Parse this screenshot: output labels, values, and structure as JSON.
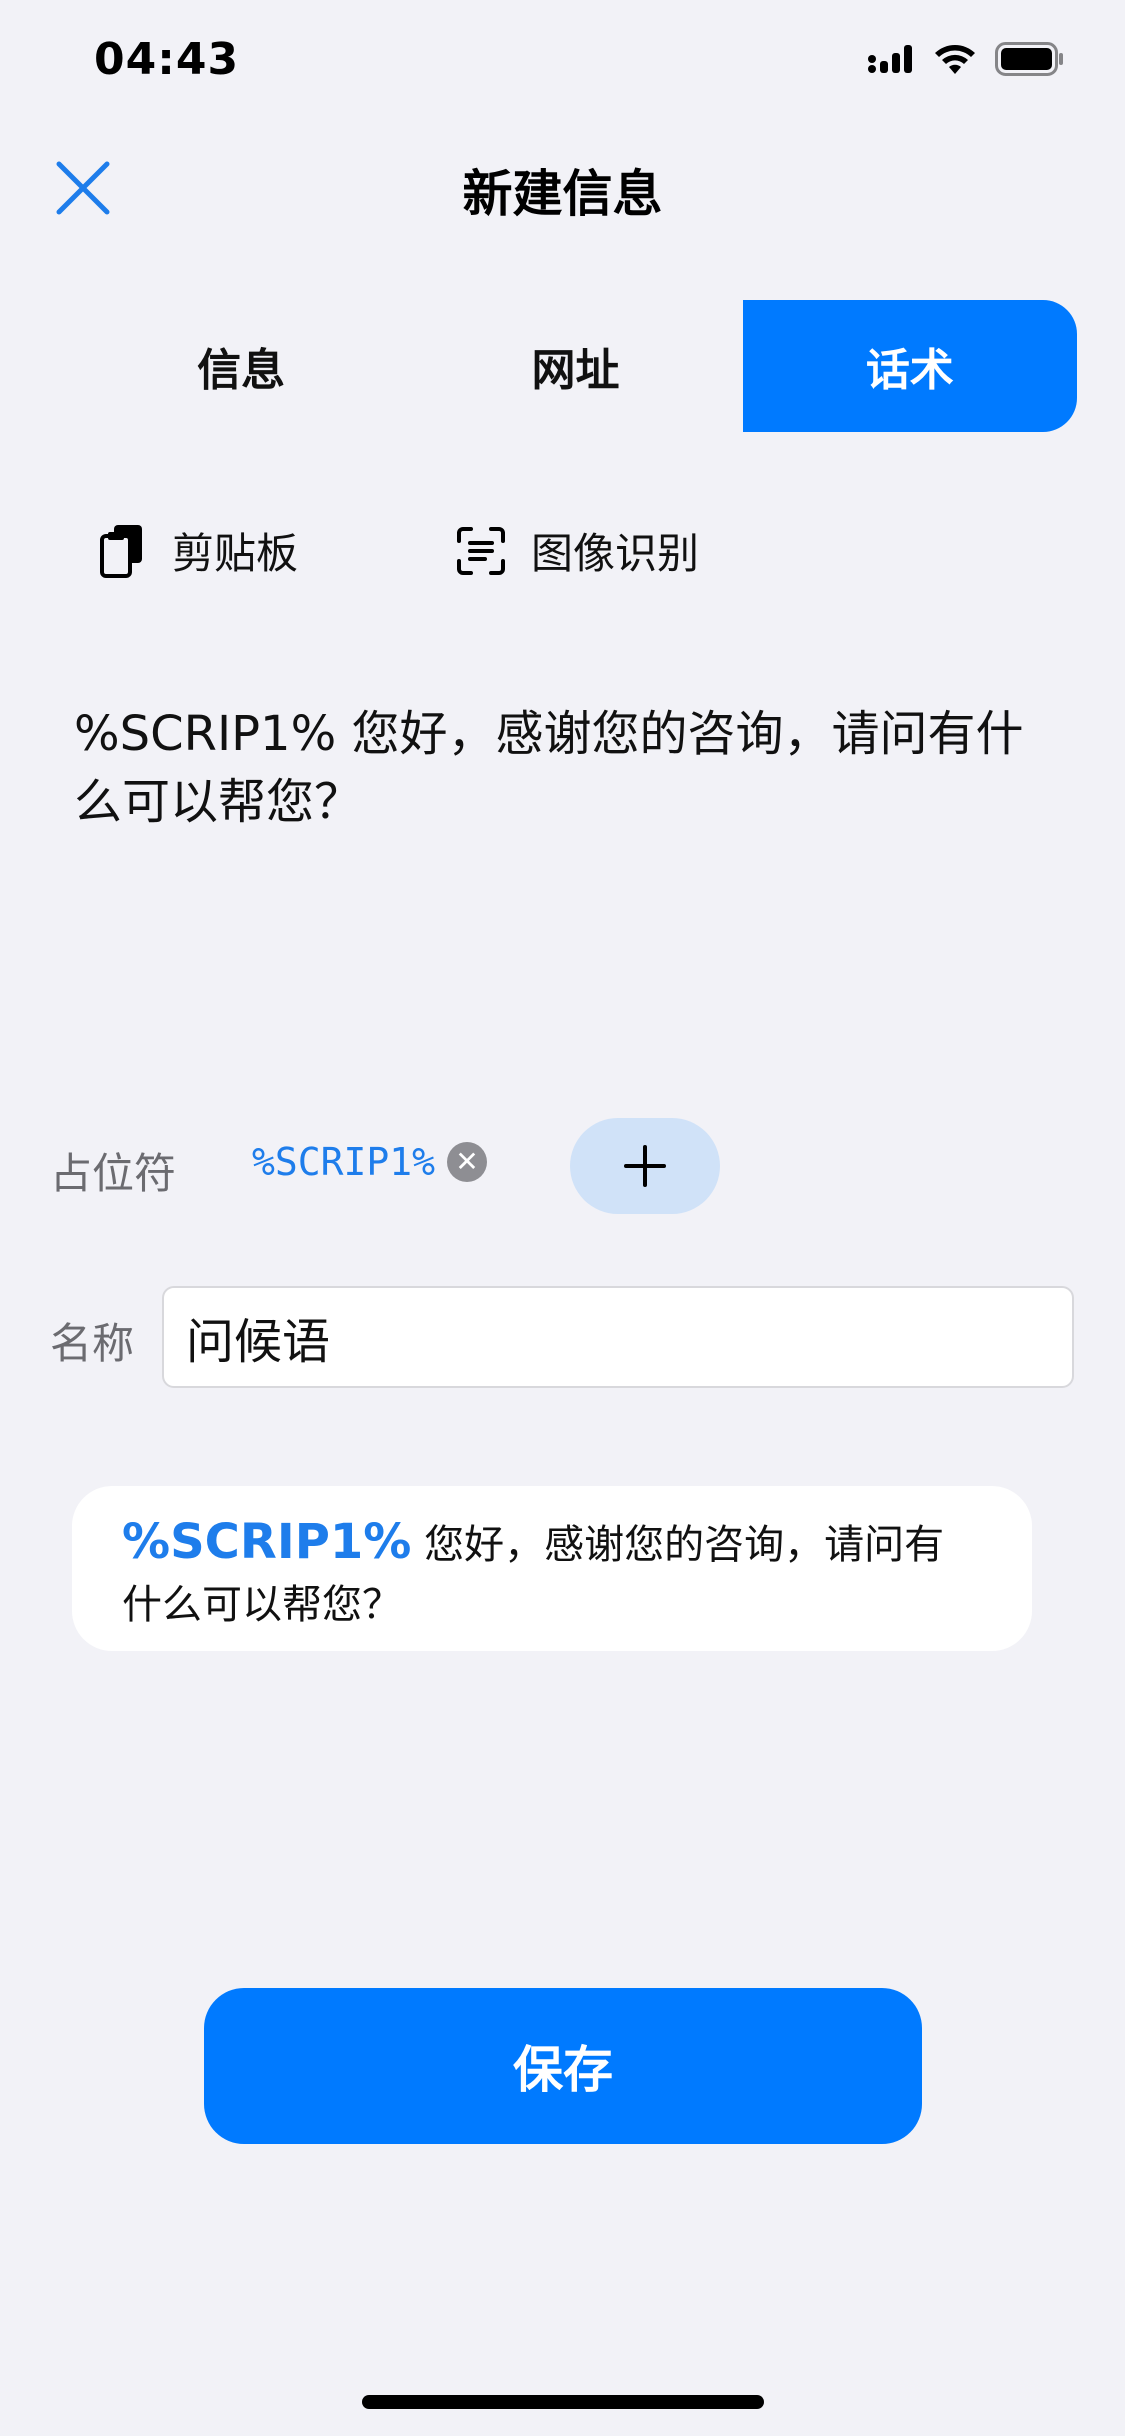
{
  "status_bar": {
    "time": "04:43"
  },
  "nav": {
    "title": "新建信息",
    "close_icon": "close-x-icon"
  },
  "tabs": [
    {
      "label": "信息",
      "active": false
    },
    {
      "label": "网址",
      "active": false
    },
    {
      "label": "话术",
      "active": true
    }
  ],
  "tools": {
    "clipboard_label": "剪贴板",
    "ocr_label": "图像识别"
  },
  "editor": {
    "text": "%SCRIP1% 您好，感谢您的咨询，请问有什么可以帮您？"
  },
  "placeholder": {
    "label": "占位符",
    "chip": "%SCRIP1%",
    "add_symbol": "+"
  },
  "name": {
    "label": "名称",
    "value": "问候语"
  },
  "preview": {
    "token": "%SCRIP1%",
    "text": " 您好，感谢您的咨询，请问有什么可以帮您？"
  },
  "save_label": "保存",
  "colors": {
    "accent": "#007AFF",
    "background": "#F2F2F7",
    "chip_bg": "#D0E2F8"
  }
}
